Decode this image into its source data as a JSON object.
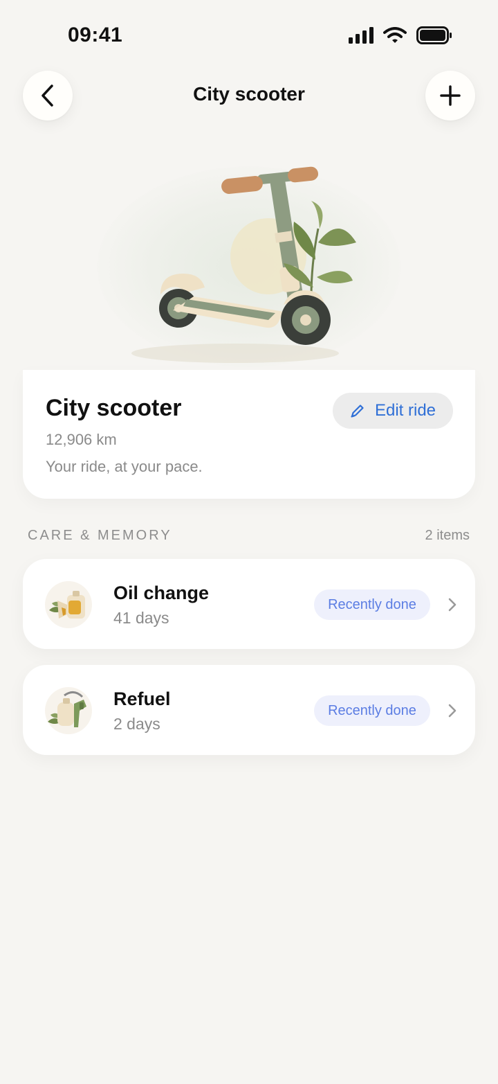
{
  "status_bar": {
    "time": "09:41"
  },
  "nav": {
    "title": "City scooter"
  },
  "ride": {
    "name": "City scooter",
    "distance": "12,906 km",
    "tagline": "Your ride, at your pace.",
    "edit_label": "Edit ride"
  },
  "section": {
    "title": "CARE & MEMORY",
    "count": "2 items"
  },
  "items": [
    {
      "title": "Oil change",
      "subtitle": "41 days",
      "badge": "Recently done",
      "icon": "oil-can-icon"
    },
    {
      "title": "Refuel",
      "subtitle": "2 days",
      "badge": "Recently done",
      "icon": "fuel-nozzle-icon"
    }
  ],
  "colors": {
    "accent": "#2f6fd6",
    "badge_bg": "#eef0fc",
    "badge_text": "#5b7de3",
    "background": "#f6f5f2"
  }
}
